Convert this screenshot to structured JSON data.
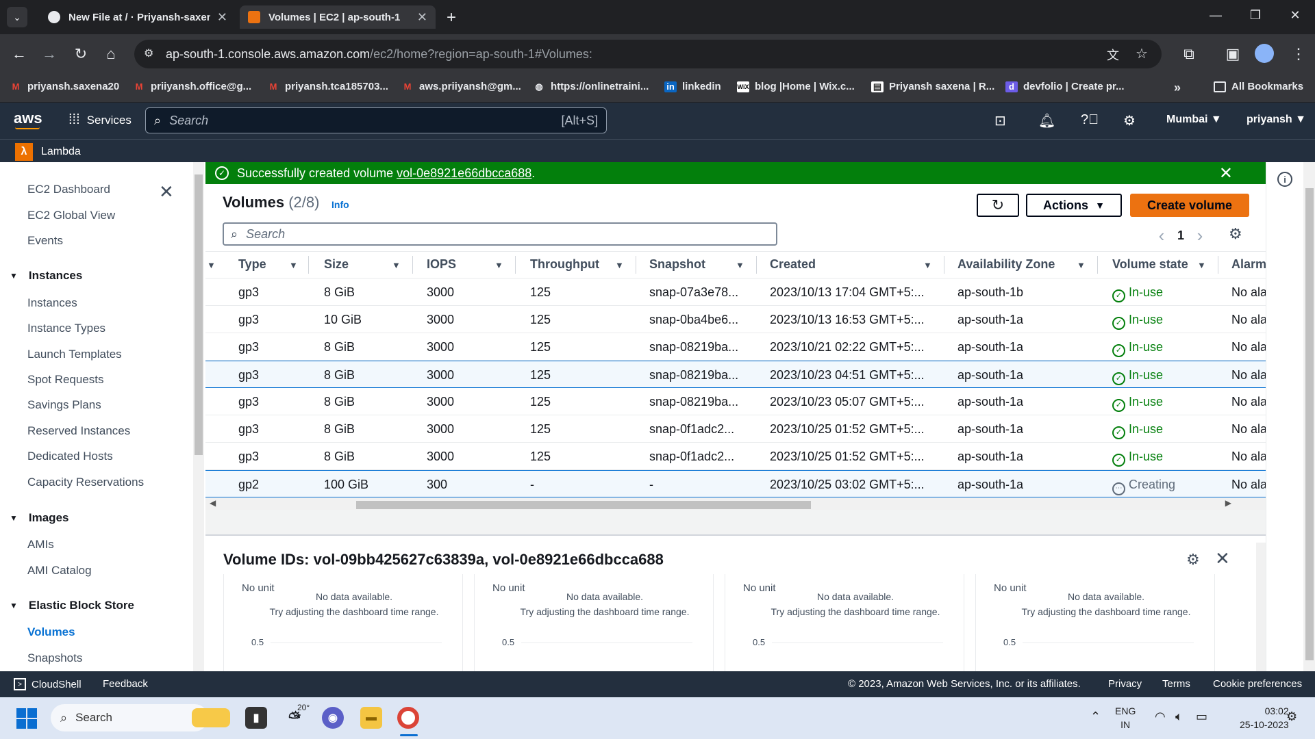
{
  "browser": {
    "tabs": [
      {
        "title": "New File at / · Priyansh-saxena",
        "active": false,
        "icon": "github-icon"
      },
      {
        "title": "Volumes | EC2 | ap-south-1",
        "active": true,
        "icon": "aws-icon"
      }
    ],
    "url_host": "ap-south-1.console.aws.amazon.com",
    "url_path": "/ec2/home?region=ap-south-1#Volumes:",
    "bookmarks": [
      {
        "label": "priyansh.saxena20",
        "icon": "gmail-icon"
      },
      {
        "label": "priiyansh.office@g...",
        "icon": "gmail-icon"
      },
      {
        "label": "priyansh.tca185703...",
        "icon": "gmail-icon"
      },
      {
        "label": "aws.priiyansh@gm...",
        "icon": "gmail-icon"
      },
      {
        "label": "https://onlinetraini...",
        "icon": "globe-icon"
      },
      {
        "label": "linkedin",
        "icon": "linkedin-icon"
      },
      {
        "label": "blog |Home | Wix.c...",
        "icon": "wix-icon"
      },
      {
        "label": "Priyansh saxena | R...",
        "icon": "page-icon"
      },
      {
        "label": "devfolio | Create pr...",
        "icon": "devfolio-icon"
      }
    ],
    "all_bookmarks": "All Bookmarks"
  },
  "aws_header": {
    "logo": "aws",
    "services": "Services",
    "search_placeholder": "Search",
    "search_shortcut": "[Alt+S]",
    "region": "Mumbai ▼",
    "user": "priyansh ▼",
    "favorite": "Lambda"
  },
  "nav": {
    "items_top": [
      "EC2 Dashboard",
      "EC2 Global View",
      "Events"
    ],
    "instances_header": "Instances",
    "instances": [
      "Instances",
      "Instance Types",
      "Launch Templates",
      "Spot Requests",
      "Savings Plans",
      "Reserved Instances",
      "Dedicated Hosts",
      "Capacity Reservations"
    ],
    "images_header": "Images",
    "images": [
      "AMIs",
      "AMI Catalog"
    ],
    "ebs_header": "Elastic Block Store",
    "ebs": [
      "Volumes",
      "Snapshots"
    ]
  },
  "flash": {
    "prefix": "Successfully created volume ",
    "volume_link": "vol-0e8921e66dbcca688",
    "suffix": "."
  },
  "volumes": {
    "title": "Volumes",
    "count": "(2/8)",
    "info": "Info",
    "actions": "Actions",
    "create": "Create volume",
    "search_placeholder": "Search",
    "page": "1",
    "columns": [
      "Type",
      "Size",
      "IOPS",
      "Throughput",
      "Snapshot",
      "Created",
      "Availability Zone",
      "Volume state",
      "Alarm"
    ],
    "rows": [
      {
        "type": "gp3",
        "size": "8 GiB",
        "iops": "3000",
        "throughput": "125",
        "snapshot": "snap-07a3e78...",
        "created": "2023/10/13 17:04 GMT+5:...",
        "az": "ap-south-1b",
        "state": "In-use",
        "alarm": "No ala",
        "selected": false
      },
      {
        "type": "gp3",
        "size": "10 GiB",
        "iops": "3000",
        "throughput": "125",
        "snapshot": "snap-0ba4be6...",
        "created": "2023/10/13 16:53 GMT+5:...",
        "az": "ap-south-1a",
        "state": "In-use",
        "alarm": "No ala",
        "selected": false
      },
      {
        "type": "gp3",
        "size": "8 GiB",
        "iops": "3000",
        "throughput": "125",
        "snapshot": "snap-08219ba...",
        "created": "2023/10/21 02:22 GMT+5:...",
        "az": "ap-south-1a",
        "state": "In-use",
        "alarm": "No ala",
        "selected": false
      },
      {
        "type": "gp3",
        "size": "8 GiB",
        "iops": "3000",
        "throughput": "125",
        "snapshot": "snap-08219ba...",
        "created": "2023/10/23 04:51 GMT+5:...",
        "az": "ap-south-1a",
        "state": "In-use",
        "alarm": "No ala",
        "selected": true
      },
      {
        "type": "gp3",
        "size": "8 GiB",
        "iops": "3000",
        "throughput": "125",
        "snapshot": "snap-08219ba...",
        "created": "2023/10/23 05:07 GMT+5:...",
        "az": "ap-south-1a",
        "state": "In-use",
        "alarm": "No ala",
        "selected": false
      },
      {
        "type": "gp3",
        "size": "8 GiB",
        "iops": "3000",
        "throughput": "125",
        "snapshot": "snap-0f1adc2...",
        "created": "2023/10/25 01:52 GMT+5:...",
        "az": "ap-south-1a",
        "state": "In-use",
        "alarm": "No ala",
        "selected": false
      },
      {
        "type": "gp3",
        "size": "8 GiB",
        "iops": "3000",
        "throughput": "125",
        "snapshot": "snap-0f1adc2...",
        "created": "2023/10/25 01:52 GMT+5:...",
        "az": "ap-south-1a",
        "state": "In-use",
        "alarm": "No ala",
        "selected": false
      },
      {
        "type": "gp2",
        "size": "100 GiB",
        "iops": "300",
        "throughput": "-",
        "snapshot": "-",
        "created": "2023/10/25 03:02 GMT+5:...",
        "az": "ap-south-1a",
        "state": "Creating",
        "alarm": "No ala",
        "selected": true
      }
    ]
  },
  "detail": {
    "title": "Volume IDs: vol-09bb425627c63839a, vol-0e8921e66dbcca688",
    "cards": [
      {
        "unit": "No unit",
        "line1": "No data available.",
        "line2": "Try adjusting the dashboard time range.",
        "tick": "0.5"
      },
      {
        "unit": "No unit",
        "line1": "No data available.",
        "line2": "Try adjusting the dashboard time range.",
        "tick": "0.5"
      },
      {
        "unit": "No unit",
        "line1": "No data available.",
        "line2": "Try adjusting the dashboard time range.",
        "tick": "0.5"
      },
      {
        "unit": "No unit",
        "line1": "No data available.",
        "line2": "Try adjusting the dashboard time range.",
        "tick": "0.5"
      }
    ]
  },
  "footer": {
    "cloudshell": "CloudShell",
    "feedback": "Feedback",
    "copyright": "© 2023, Amazon Web Services, Inc. or its affiliates.",
    "privacy": "Privacy",
    "terms": "Terms",
    "cookies": "Cookie preferences"
  },
  "taskbar": {
    "search": "Search",
    "weather": "20°",
    "lang1": "ENG",
    "lang2": "IN",
    "time": "03:02",
    "date": "25-10-2023"
  },
  "colors": {
    "aws_header": "#232f3e",
    "success": "#037f0c",
    "primary_button": "#ec7211",
    "link": "#0972d3"
  }
}
